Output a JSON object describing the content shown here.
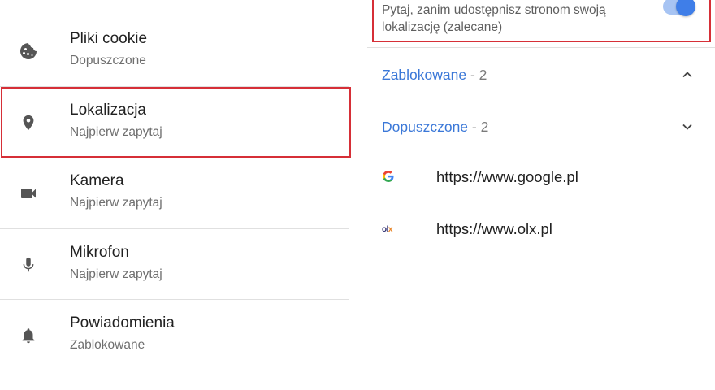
{
  "permissions": [
    {
      "title": "Pliki cookie",
      "status": "Dopuszczone",
      "icon": "cookie-icon"
    },
    {
      "title": "Lokalizacja",
      "status": "Najpierw zapytaj",
      "icon": "location-pin-icon"
    },
    {
      "title": "Kamera",
      "status": "Najpierw zapytaj",
      "icon": "camera-icon"
    },
    {
      "title": "Mikrofon",
      "status": "Najpierw zapytaj",
      "icon": "microphone-icon"
    },
    {
      "title": "Powiadomienia",
      "status": "Zablokowane",
      "icon": "bell-icon"
    }
  ],
  "location": {
    "toggle_text": "Pytaj, zanim udostępnisz stronom swoją lokalizację (zalecane)",
    "toggle_on": true,
    "blocked": {
      "label": "Zablokowane",
      "count": "- 2",
      "expanded": true
    },
    "allowed": {
      "label": "Dopuszczone",
      "count": "- 2",
      "expanded": false
    },
    "sites": [
      {
        "url": "https://www.google.pl",
        "favicon_text": "G"
      },
      {
        "url": "https://www.olx.pl",
        "favicon_text": "olx"
      }
    ]
  },
  "colors": {
    "accent_blue": "#3b78d8",
    "highlight_red": "#d62f37",
    "icon_gray": "#555555"
  }
}
